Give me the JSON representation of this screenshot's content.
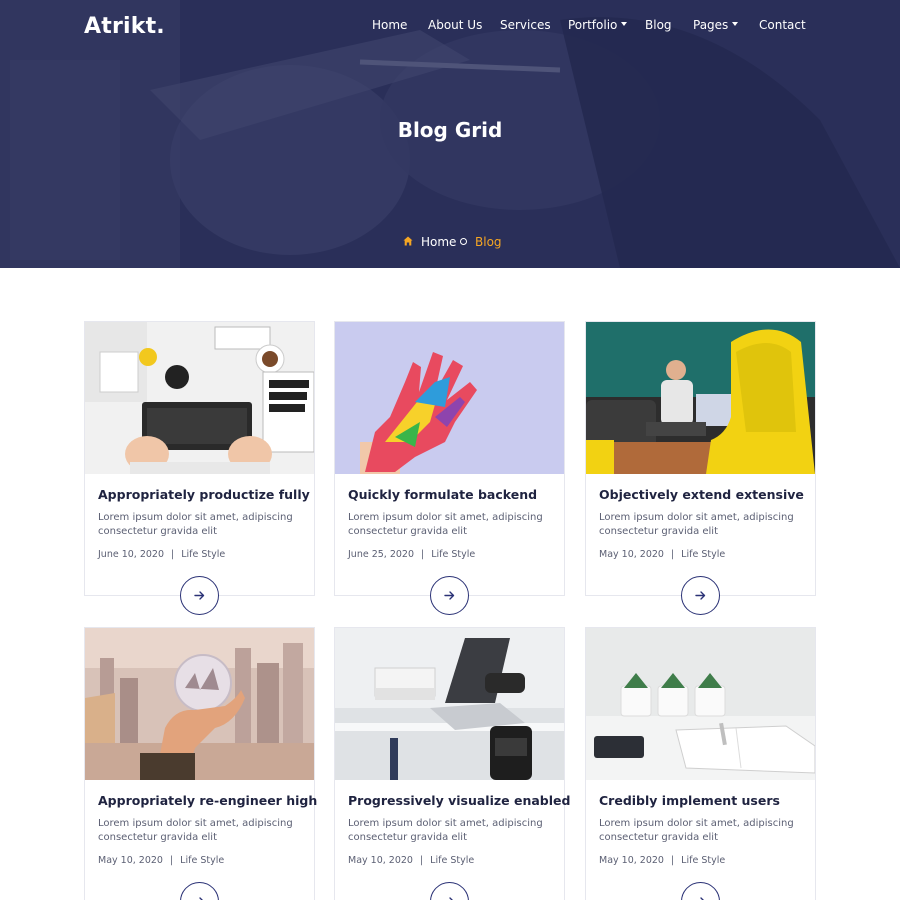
{
  "header": {
    "logo": "Atrikt.",
    "nav": [
      {
        "label": "Home",
        "dropdown": false
      },
      {
        "label": "About Us",
        "dropdown": false
      },
      {
        "label": "Services",
        "dropdown": false
      },
      {
        "label": "Portfolio",
        "dropdown": true
      },
      {
        "label": "Blog",
        "dropdown": false
      },
      {
        "label": "Pages",
        "dropdown": true
      },
      {
        "label": "Contact",
        "dropdown": false
      }
    ]
  },
  "hero": {
    "title": "Blog Grid",
    "breadcrumb": {
      "home": "Home",
      "current": "Blog"
    }
  },
  "colors": {
    "accent": "#f5a623",
    "primary": "#2b3276",
    "hero_overlay": "#1e224e"
  },
  "posts": [
    {
      "title": "Appropriately productize fully",
      "excerpt": "Lorem ipsum dolor sit amet, adipiscing consectetur gravida elit",
      "date": "June 10, 2020",
      "category": "Life Style",
      "image": "desk-keyboard-photo"
    },
    {
      "title": "Quickly formulate backend",
      "excerpt": "Lorem ipsum dolor sit amet, adipiscing consectetur gravida elit",
      "date": "June 25, 2020",
      "category": "Life Style",
      "image": "painted-hand-photo"
    },
    {
      "title": "Objectively extend extensive",
      "excerpt": "Lorem ipsum dolor sit amet, adipiscing consectetur gravida elit",
      "date": "May 10, 2020",
      "category": "Life Style",
      "image": "office-yellow-chair-photo"
    },
    {
      "title": "Appropriately re-engineer high",
      "excerpt": "Lorem ipsum dolor sit amet, adipiscing consectetur gravida elit",
      "date": "May 10, 2020",
      "category": "Life Style",
      "image": "crystal-ball-city-photo"
    },
    {
      "title": "Progressively visualize enabled",
      "excerpt": "Lorem ipsum dolor sit amet, adipiscing consectetur gravida elit",
      "date": "May 10, 2020",
      "category": "Life Style",
      "image": "laptop-desk-photo"
    },
    {
      "title": "Credibly implement users",
      "excerpt": "Lorem ipsum dolor sit amet, adipiscing consectetur gravida elit",
      "date": "May 10, 2020",
      "category": "Life Style",
      "image": "plants-notebook-photo"
    }
  ]
}
